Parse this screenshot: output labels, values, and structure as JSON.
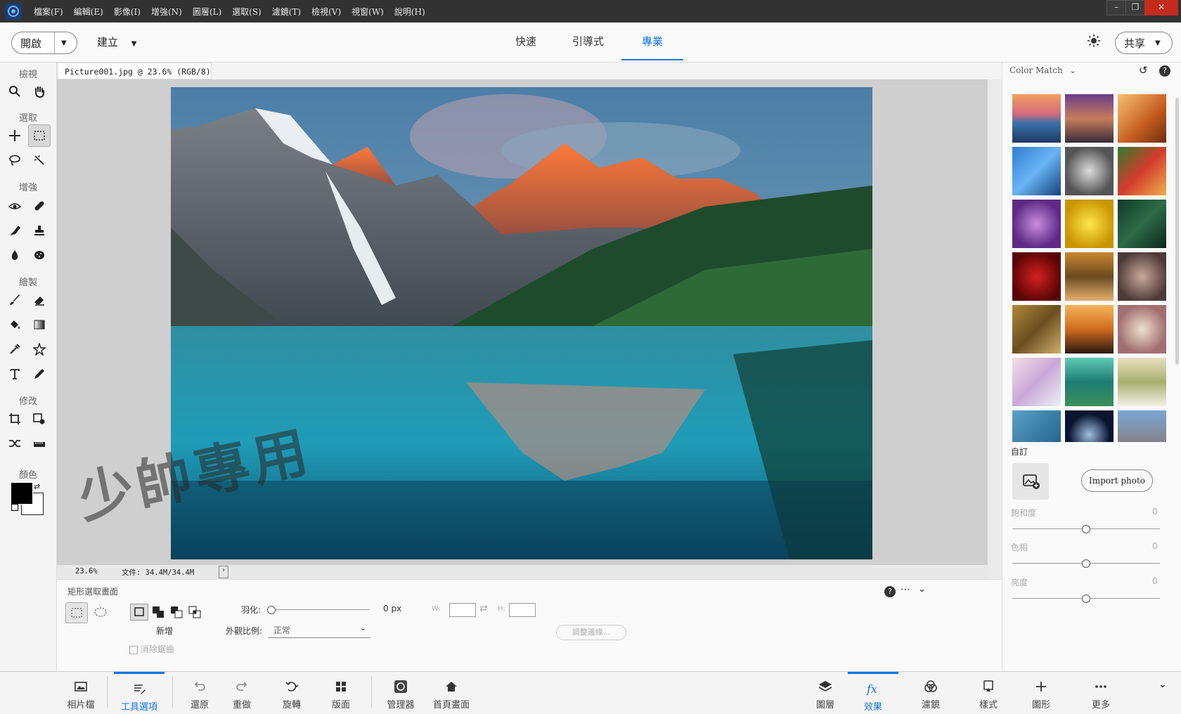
{
  "menubar": {
    "items": [
      "檔案(F)",
      "編輯(E)",
      "影像(I)",
      "增強(N)",
      "圖層(L)",
      "選取(S)",
      "濾鏡(T)",
      "檢視(V)",
      "視窗(W)",
      "說明(H)"
    ]
  },
  "topbar": {
    "open_label": "開啟",
    "create_label": "建立",
    "tabs": [
      "快速",
      "引導式",
      "專業"
    ],
    "active_tab": "專業",
    "share_label": "共享"
  },
  "lefttools": {
    "sections": [
      "檢視",
      "選取",
      "增強",
      "繪製",
      "修改",
      "顏色"
    ]
  },
  "document": {
    "tab_title": "Picture001.jpg @ 23.6% (RGB/8)",
    "zoom": "23.6%",
    "file_info": "文件: 34.4M/34.4M"
  },
  "watermark": "少帥專用",
  "tool_options": {
    "title": "矩形選取畫面",
    "new_label": "新增",
    "antialias_label": "消除鋸齒",
    "feather_label": "羽化:",
    "feather_value": "0 px",
    "feather_fraction": 0,
    "aspect_label": "外觀比例:",
    "aspect_value": "正常",
    "w_label": "W:",
    "h_label": "H:",
    "refine_label": "調整邊緣..."
  },
  "right_panel": {
    "title": "Color Match",
    "custom_label": "自訂",
    "import_label": "Import photo",
    "sliders": [
      {
        "label": "飽和度",
        "value": "0",
        "fraction": 0.5
      },
      {
        "label": "色相",
        "value": "0",
        "fraction": 0.5
      },
      {
        "label": "亮度",
        "value": "0",
        "fraction": 0.5
      }
    ]
  },
  "bottombar": {
    "left": [
      "相片檔",
      "工具選項",
      "還原",
      "重做",
      "旋轉",
      "版面",
      "管理器",
      "首頁畫面"
    ],
    "right": [
      "圖層",
      "效果",
      "濾鏡",
      "樣式",
      "圖形",
      "更多"
    ],
    "active_left": "工具選項",
    "active_right": "效果"
  },
  "colors": {
    "accent": "#1473e6",
    "menubar_bg": "#323232",
    "foreground_swatch": "#000000",
    "background_swatch": "#ffffff"
  }
}
